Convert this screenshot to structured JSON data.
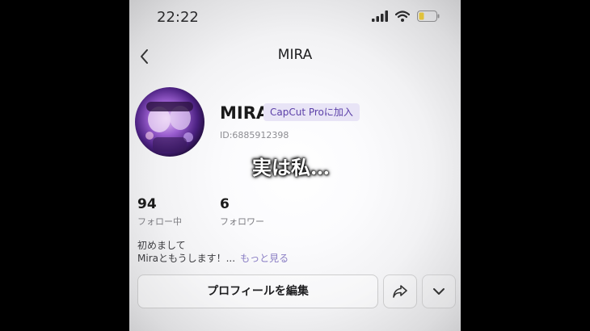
{
  "status_bar": {
    "time": "22:22"
  },
  "nav": {
    "title": "MIRA"
  },
  "profile": {
    "username": "MIRA",
    "badge": "CapCut Proに加入",
    "user_id": "ID:6885912398"
  },
  "caption": "実は私…",
  "stats": {
    "following": {
      "value": "94",
      "label": "フォロー中"
    },
    "followers": {
      "value": "6",
      "label": "フォロワー"
    }
  },
  "bio": {
    "line1": "初めまして",
    "line2": "Miraともうします！...",
    "more": "もっと見る"
  },
  "buttons": {
    "edit_profile": "プロフィールを編集"
  },
  "colors": {
    "badge_bg": "#e8e4f6",
    "badge_text": "#5b3fa8",
    "link": "#8a7ec4"
  }
}
